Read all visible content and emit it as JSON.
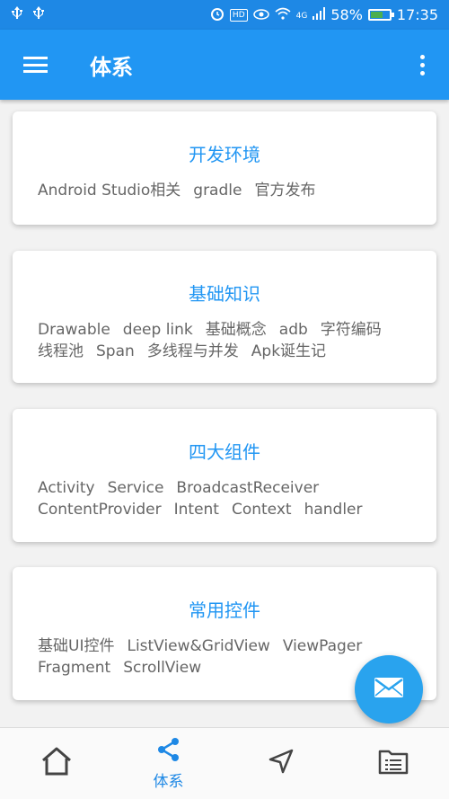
{
  "status_bar": {
    "usb_icons": [
      "usb-icon",
      "usb-icon"
    ],
    "hd_label": "HD",
    "network_label": "4G",
    "battery": "58%",
    "battery_level": 0.58,
    "time": "17:35"
  },
  "app_bar": {
    "title": "体系",
    "menu_icon": "hamburger-menu-icon",
    "more_icon": "more-vert-icon",
    "color": "#2196f3"
  },
  "cards": [
    {
      "title": "开发环境",
      "tags": [
        "Android Studio相关",
        "gradle",
        "官方发布"
      ]
    },
    {
      "title": "基础知识",
      "tags": [
        "Drawable",
        "deep link",
        "基础概念",
        "adb",
        "字符编码",
        "线程池",
        "Span",
        "多线程与并发",
        "Apk诞生记"
      ]
    },
    {
      "title": "四大组件",
      "tags": [
        "Activity",
        "Service",
        "BroadcastReceiver",
        "ContentProvider",
        "Intent",
        "Context",
        "handler"
      ]
    },
    {
      "title": "常用控件",
      "tags": [
        "基础UI控件",
        "ListView&GridView",
        "ViewPager",
        "Fragment",
        "ScrollView"
      ]
    }
  ],
  "fab": {
    "icon": "mail-icon",
    "color": "#29a3ee"
  },
  "bottom_nav": {
    "items": [
      {
        "icon": "home-icon",
        "label": ""
      },
      {
        "icon": "share-icon",
        "label": "体系"
      },
      {
        "icon": "navigation-icon",
        "label": ""
      },
      {
        "icon": "list-folder-icon",
        "label": ""
      }
    ],
    "active_color": "#1e88e5"
  }
}
